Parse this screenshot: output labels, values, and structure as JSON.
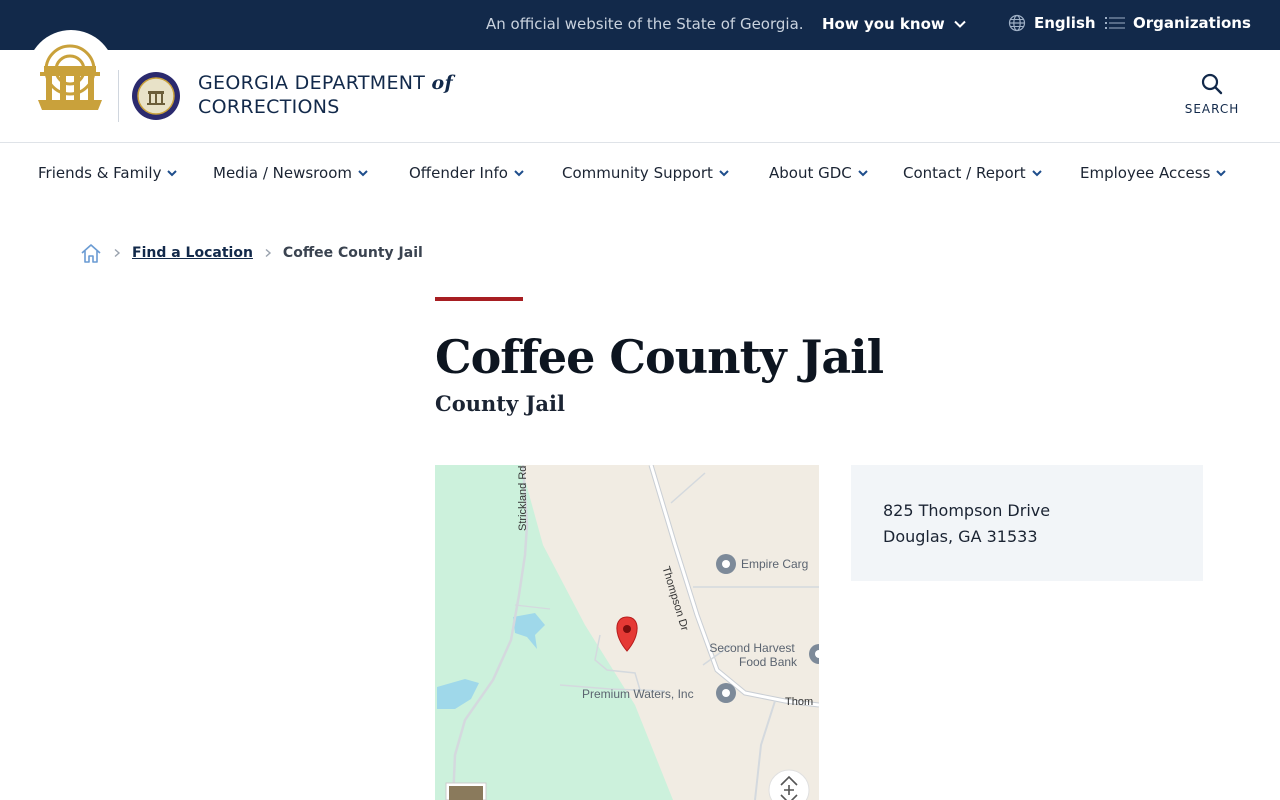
{
  "banner": {
    "official_text": "An official website of the State of Georgia.",
    "how_you_know": "How you know",
    "language": "English",
    "organizations": "Organizations"
  },
  "header": {
    "dept_line1": "GEORGIA DEPARTMENT",
    "dept_of": "of",
    "dept_line2": "CORRECTIONS",
    "search_label": "SEARCH"
  },
  "nav": {
    "items": [
      {
        "label": "Friends & Family"
      },
      {
        "label": "Media / Newsroom"
      },
      {
        "label": "Offender Info"
      },
      {
        "label": "Community Support"
      },
      {
        "label": "About GDC"
      },
      {
        "label": "Contact / Report"
      },
      {
        "label": "Employee Access"
      }
    ]
  },
  "breadcrumb": {
    "parent": "Find a Location",
    "current": "Coffee County Jail"
  },
  "page": {
    "title": "Coffee County Jail",
    "subtitle": "County Jail"
  },
  "map": {
    "labels": {
      "strickland": "Strickland Rd",
      "thompson_dr": "Thompson Dr",
      "thompson_partial": "Thom",
      "empire": "Empire Carg",
      "second_harvest_1": "Second Harvest",
      "second_harvest_2": "Food Bank",
      "premium": "Premium Waters, Inc"
    }
  },
  "address": {
    "line1": "825 Thompson Drive",
    "line2": "Douglas, GA 31533"
  },
  "colors": {
    "banner_bg": "#12294a",
    "accent": "#a71e22",
    "nav_chevron": "#1f4e8c",
    "card_bg": "#f2f5f8"
  }
}
